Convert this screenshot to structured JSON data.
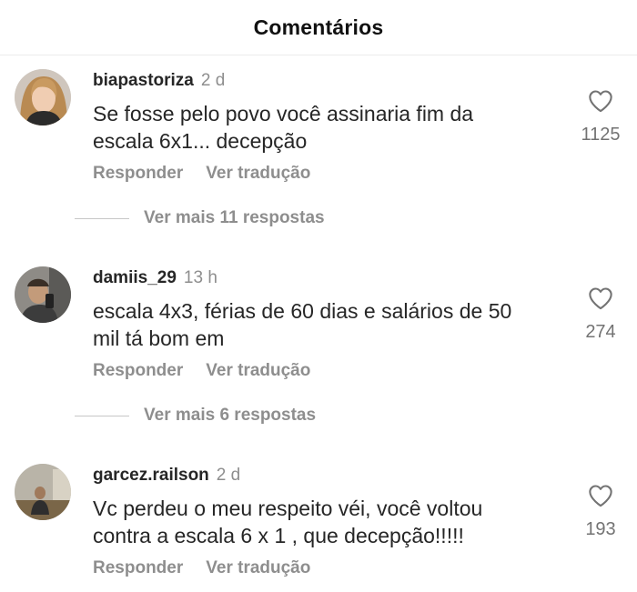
{
  "header": {
    "title": "Comentários"
  },
  "actions": {
    "reply": "Responder",
    "translate": "Ver tradução"
  },
  "comments": [
    {
      "username": "biapastoriza",
      "time": "2 d",
      "text_line1": "Se fosse pelo povo você assinaria fim da",
      "text_line2": "escala 6x1... decepção",
      "likes": "1125",
      "replies": "Ver mais 11 respostas"
    },
    {
      "username": "damiis_29",
      "time": "13 h",
      "text_line1": "escala 4x3, férias de 60 dias e salários de 50",
      "text_line2": "mil tá bom em",
      "likes": "274",
      "replies": "Ver mais 6 respostas"
    },
    {
      "username": "garcez.railson",
      "time": "2 d",
      "text_line1": "Vc perdeu o meu respeito véi, você voltou",
      "text_line2": "contra a escala 6 x 1 , que decepção!!!!!",
      "likes": "193"
    }
  ],
  "colors": {
    "text": "#262626",
    "secondary": "#8e8e8e",
    "divider": "#ececec"
  }
}
